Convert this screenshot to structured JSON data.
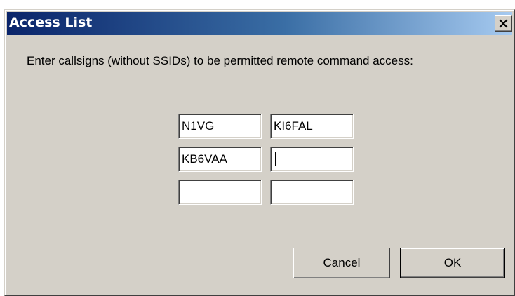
{
  "window": {
    "title": "Access List",
    "close_glyph": "close-icon"
  },
  "prompt": "Enter callsigns (without SSIDs) to be permitted remote command access:",
  "callsigns": [
    [
      "N1VG",
      "KI6FAL"
    ],
    [
      "KB6VAA",
      ""
    ],
    [
      "",
      ""
    ]
  ],
  "buttons": {
    "cancel": "Cancel",
    "ok": "OK"
  }
}
